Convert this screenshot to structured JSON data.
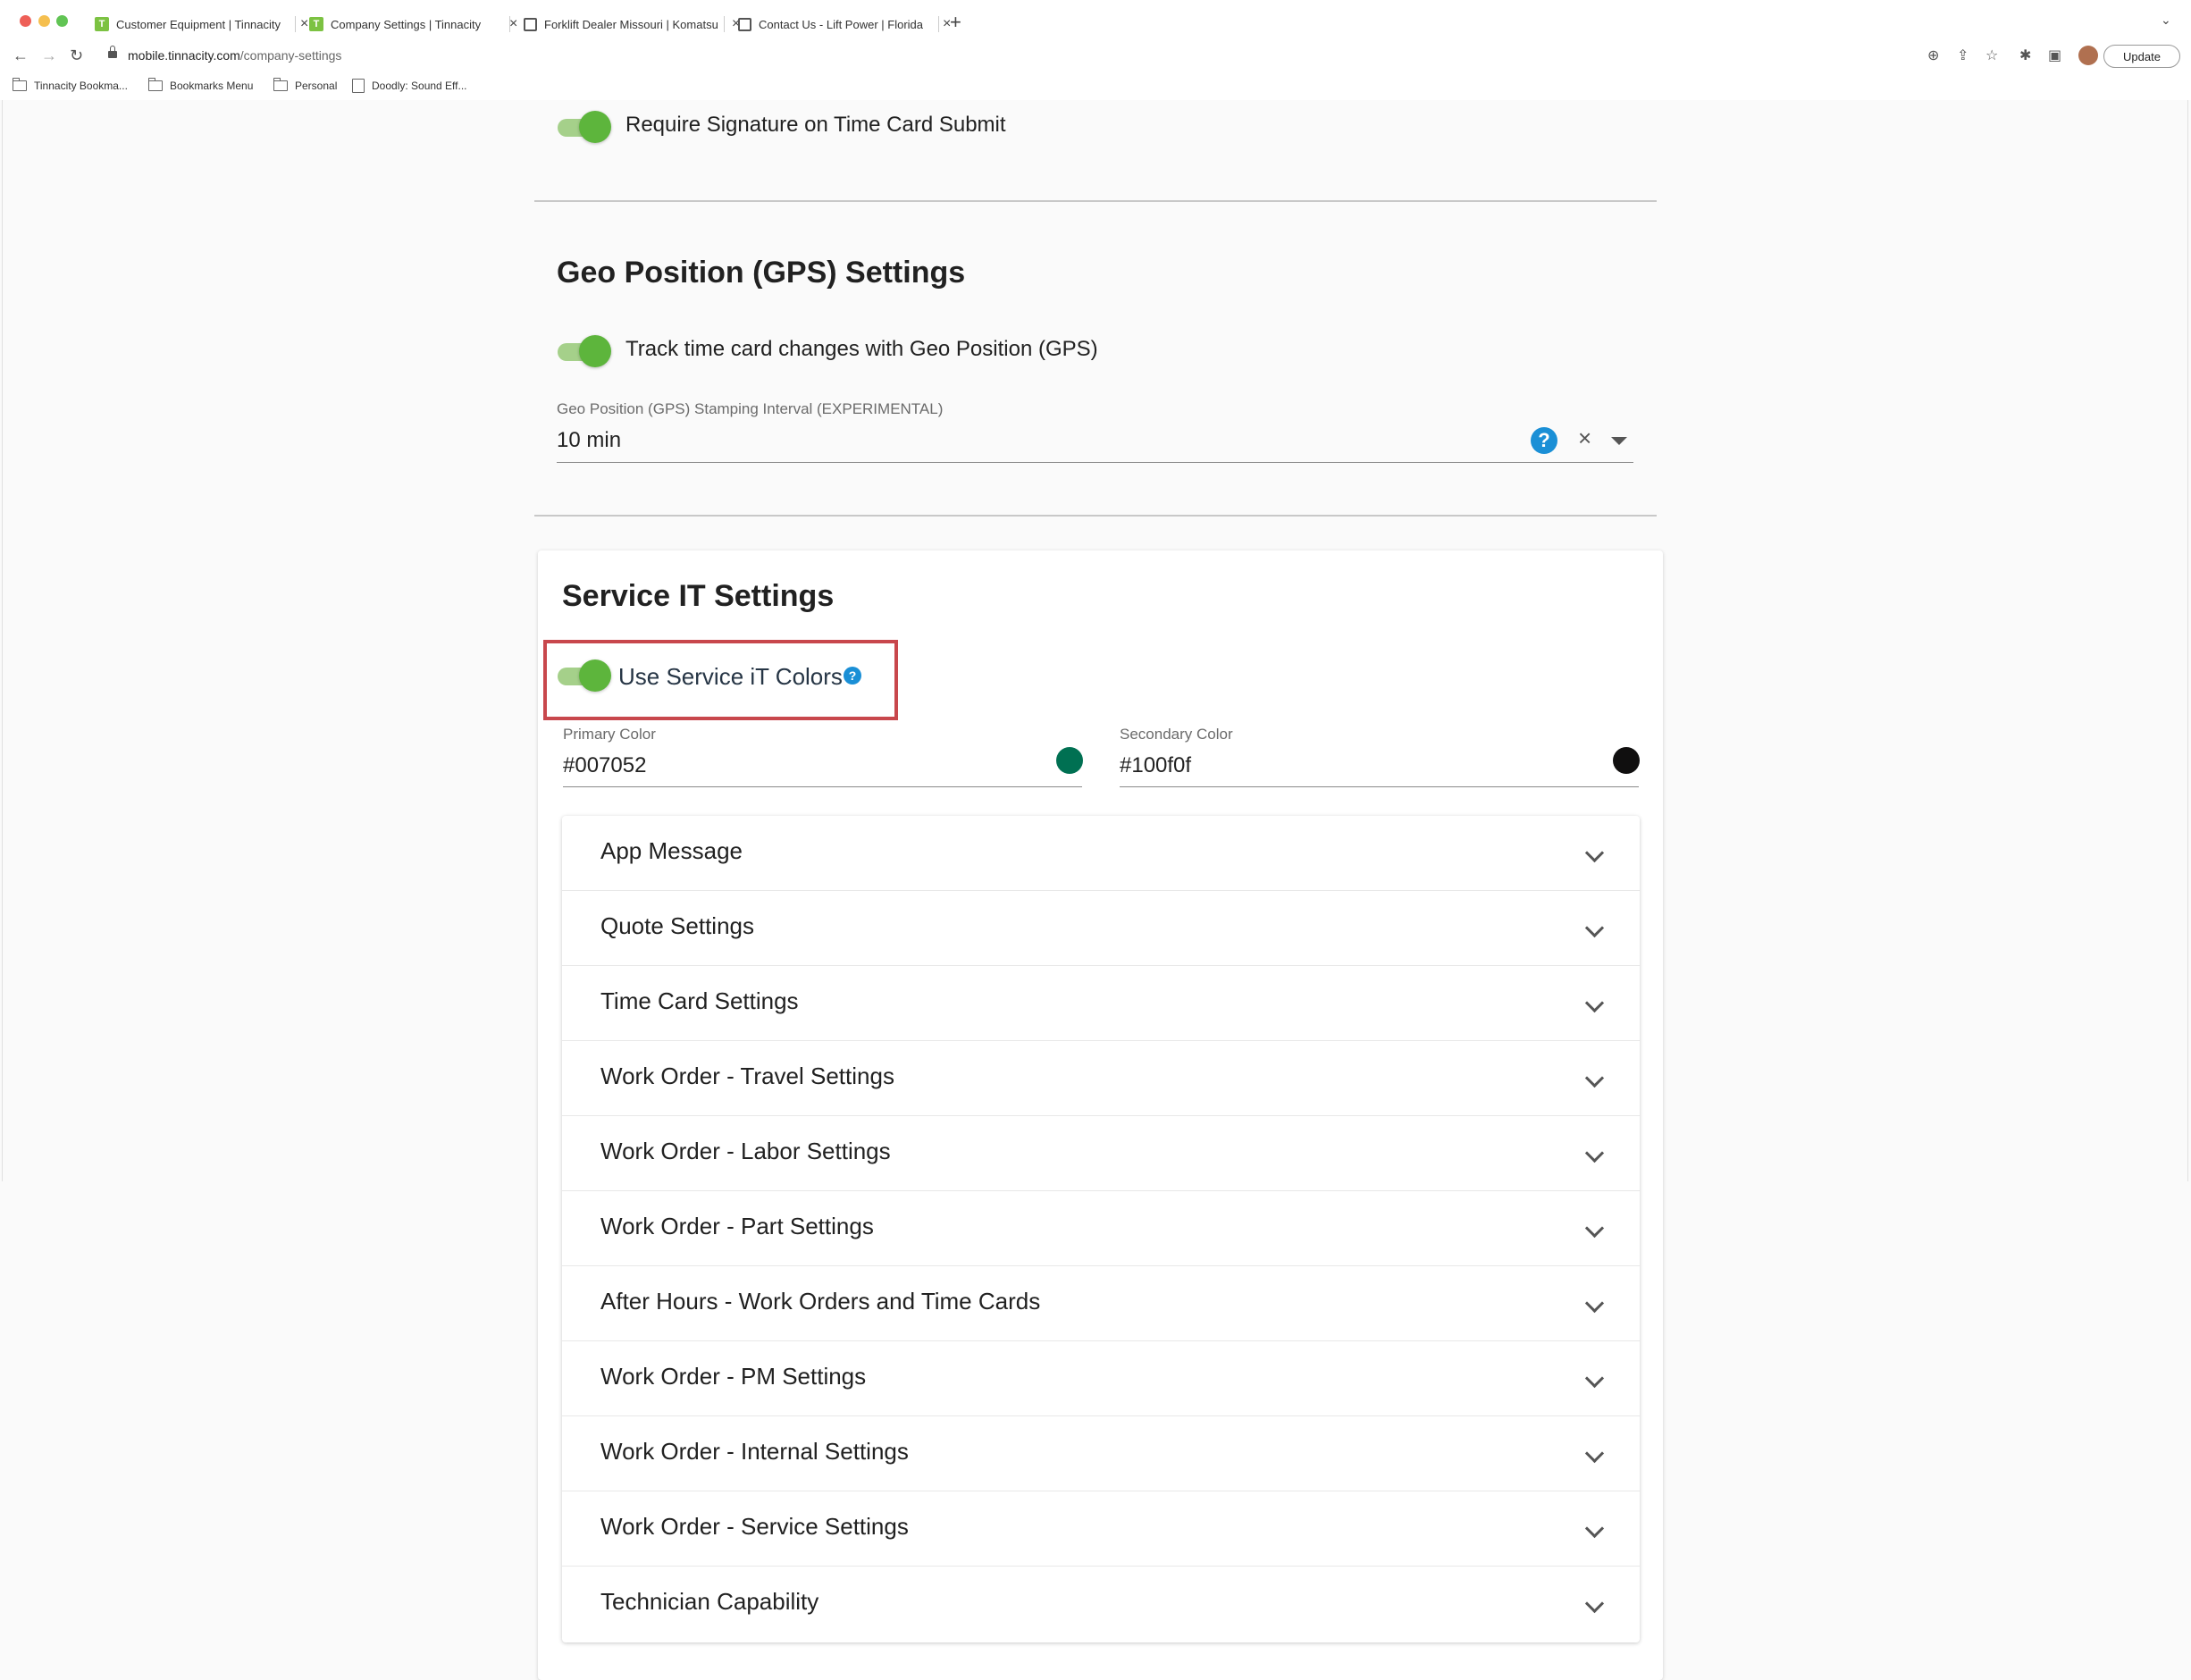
{
  "browser": {
    "tabs": [
      {
        "label": "Customer Equipment | Tinnacity",
        "favicon": "tinnacity-icon"
      },
      {
        "label": "Company Settings | Tinnacity",
        "favicon": "tinnacity-icon"
      },
      {
        "label": "Forklift Dealer Missouri | Komatsu",
        "favicon": "globe-icon"
      },
      {
        "label": "Contact Us - Lift Power | Florida",
        "favicon": "globe-icon"
      }
    ],
    "new_tab": "+",
    "url_host": "mobile.tinnacity.com",
    "url_path": "/company-settings",
    "update_label": "Update",
    "bookmarks": [
      {
        "label": "Tinnacity Bookma...",
        "icon": "folder-icon"
      },
      {
        "label": "Bookmarks Menu",
        "icon": "folder-icon"
      },
      {
        "label": "Personal",
        "icon": "folder-icon"
      },
      {
        "label": "Doodly: Sound Eff...",
        "icon": "page-icon"
      }
    ]
  },
  "settings": {
    "require_signature": {
      "label": "Require Signature on Time Card Submit",
      "enabled": true
    },
    "gps": {
      "title": "Geo Position (GPS) Settings",
      "track_toggle": {
        "label": "Track time card changes with Geo Position (GPS)",
        "enabled": true
      },
      "interval": {
        "caption": "Geo Position (GPS) Stamping Interval (EXPERIMENTAL)",
        "value": "10 min"
      }
    },
    "service_it": {
      "title": "Service IT Settings",
      "use_colors": {
        "label": "Use Service iT Colors",
        "enabled": true
      },
      "primary": {
        "caption": "Primary Color",
        "value": "#007052",
        "swatch": "#007052"
      },
      "secondary": {
        "caption": "Secondary Color",
        "value": "#100f0f",
        "swatch": "#100f0f"
      },
      "panels": [
        "App Message",
        "Quote Settings",
        "Time Card Settings",
        "Work Order - Travel Settings",
        "Work Order - Labor Settings",
        "Work Order - Part Settings",
        "After Hours - Work Orders and Time Cards",
        "Work Order - PM Settings",
        "Work Order - Internal Settings",
        "Work Order - Service Settings",
        "Technician Capability"
      ]
    }
  },
  "colors": {
    "toggle_on": "#5db53c",
    "help_blue": "#1a8fd6",
    "highlight_red": "#c8474c"
  }
}
